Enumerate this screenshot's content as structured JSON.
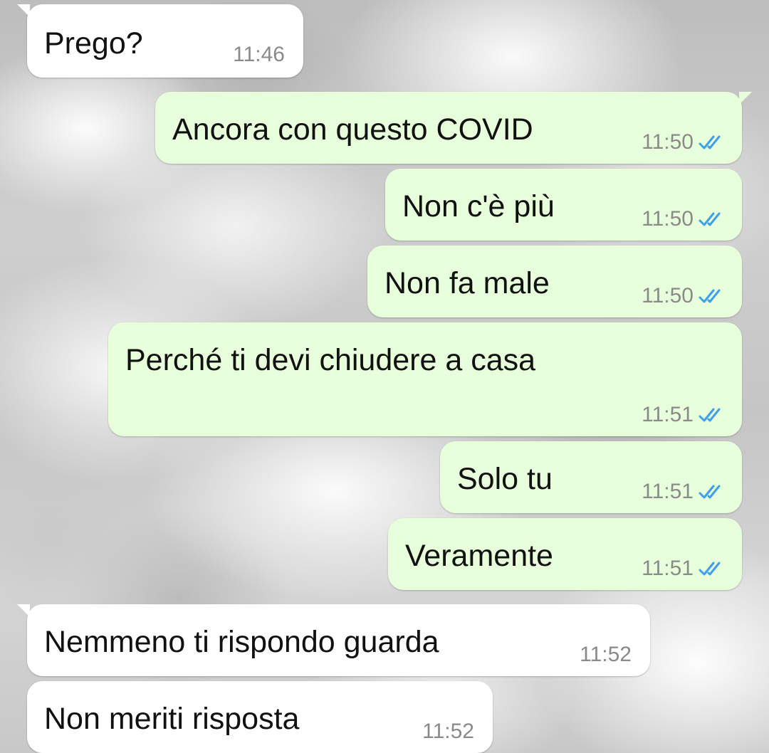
{
  "colors": {
    "incoming_bubble": "#ffffff",
    "outgoing_bubble": "#e7ffdb",
    "timestamp": "#8a8a8a",
    "read_receipt": "#3ca0ea",
    "message_text": "#111111"
  },
  "messages": [
    {
      "direction": "incoming",
      "text": "Prego?",
      "time": "11:46"
    },
    {
      "direction": "outgoing",
      "text": "Ancora con questo COVID",
      "time": "11:50",
      "status_icon": "double-check-read-icon"
    },
    {
      "direction": "outgoing",
      "text": "Non c'è più",
      "time": "11:50",
      "status_icon": "double-check-read-icon"
    },
    {
      "direction": "outgoing",
      "text": "Non fa male",
      "time": "11:50",
      "status_icon": "double-check-read-icon"
    },
    {
      "direction": "outgoing",
      "text": "Perché ti devi chiudere a casa",
      "time": "11:51",
      "status_icon": "double-check-read-icon"
    },
    {
      "direction": "outgoing",
      "text": "Solo tu",
      "time": "11:51",
      "status_icon": "double-check-read-icon"
    },
    {
      "direction": "outgoing",
      "text": "Veramente",
      "time": "11:51",
      "status_icon": "double-check-read-icon"
    },
    {
      "direction": "incoming",
      "text": "Nemmeno ti rispondo guarda",
      "time": "11:52"
    },
    {
      "direction": "incoming",
      "text": "Non meriti risposta",
      "time": "11:52"
    }
  ]
}
